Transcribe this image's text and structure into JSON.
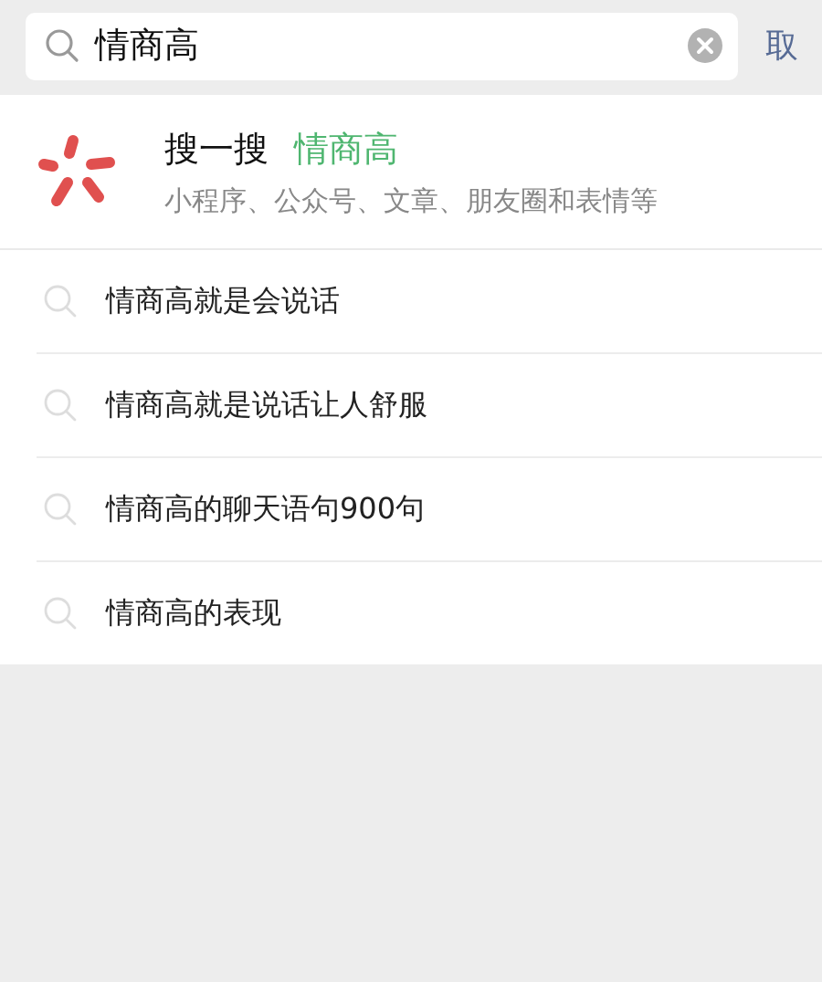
{
  "search": {
    "value": "情商高",
    "cancel": "取"
  },
  "search_one": {
    "title": "搜一搜",
    "query": "情商高",
    "subtitle": "小程序、公众号、文章、朋友圈和表情等"
  },
  "suggestions": [
    "情商高就是会说话",
    "情商高就是说话让人舒服",
    "情商高的聊天语句900句",
    "情商高的表现"
  ]
}
